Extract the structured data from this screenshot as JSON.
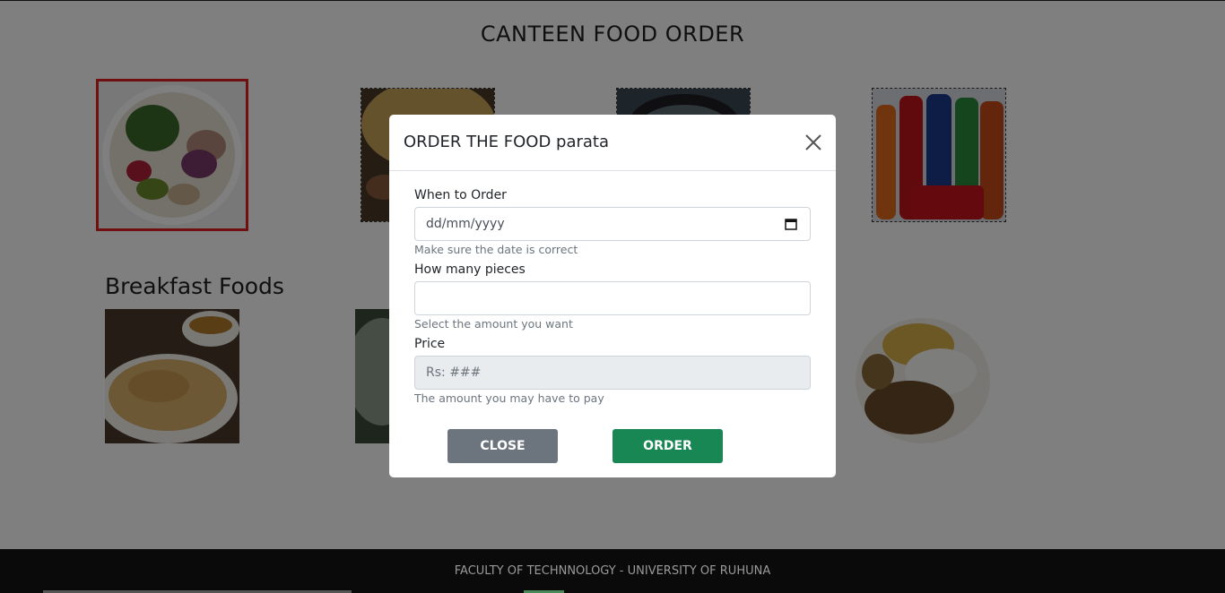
{
  "page": {
    "title": "CANTEEN FOOD ORDER",
    "section_heading": "Breakfast Foods",
    "footer_text": "FACULTY OF TECHNNOLOGY - UNIVERSITY OF RUHUNA"
  },
  "modal": {
    "title": "ORDER THE FOOD parata",
    "date_label": "When to Order",
    "date_placeholder": "dd/mm/yyyy",
    "date_help": "Make sure the date is correct",
    "pieces_label": "How many pieces",
    "pieces_value": "",
    "pieces_help": "Select the amount you want",
    "price_label": "Price",
    "price_placeholder": "Rs: ###",
    "price_help": "The amount you may have to pay",
    "close_button": "CLOSE",
    "order_button": "ORDER"
  },
  "icons": [
    "close-icon",
    "calendar-icon"
  ],
  "colors": {
    "close_button": "#6c757d",
    "order_button": "#198754",
    "selected_border": "#e02020",
    "footer": "#0a0a0a"
  }
}
